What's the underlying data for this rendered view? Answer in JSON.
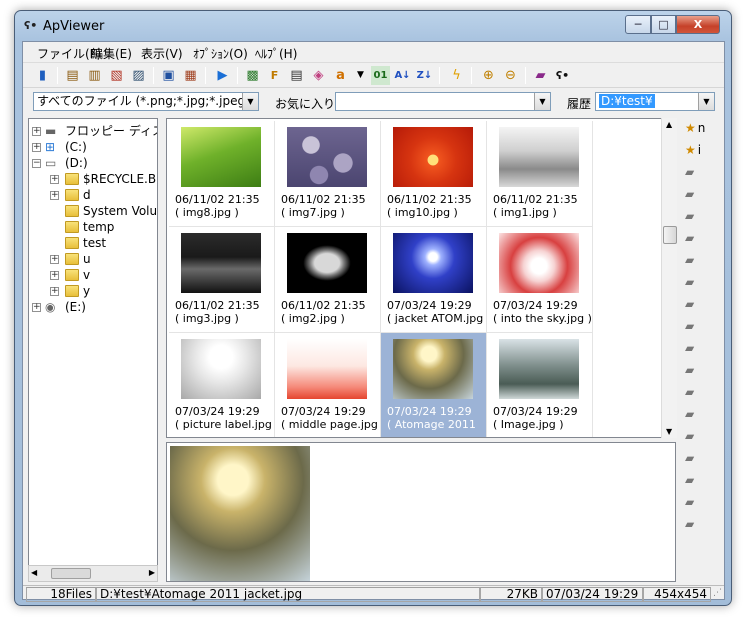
{
  "window": {
    "title": "ApViewer",
    "min": "─",
    "max": "□",
    "close": "X"
  },
  "menu": [
    "ファイル(F)",
    "編集(E)",
    "表示(V)",
    "ｵﾌﾟｼｮﾝ(O)",
    "ﾍﾙﾌﾟ(H)"
  ],
  "filter": {
    "value": "すべてのファイル (*.png;*.jpg;*.jpeg;*.bm"
  },
  "favorites": {
    "label": "お気に入り",
    "value": ""
  },
  "history": {
    "label": "履歴",
    "value": "D:¥test¥"
  },
  "tree": [
    {
      "label": "フロッピー ディスク",
      "icon": "floppy-icon",
      "pm": "+",
      "level": 0
    },
    {
      "label": "(C:)",
      "icon": "windows-drive-icon",
      "pm": "+",
      "level": 0
    },
    {
      "label": "(D:)",
      "icon": "drive-icon",
      "pm": "−",
      "level": 0
    },
    {
      "label": "$RECYCLE.BIN",
      "icon": "folder-icon",
      "pm": "+",
      "level": 1
    },
    {
      "label": "d",
      "icon": "folder-icon",
      "pm": "+",
      "level": 1
    },
    {
      "label": "System Volume",
      "icon": "folder-icon",
      "pm": "",
      "level": 1
    },
    {
      "label": "temp",
      "icon": "folder-icon",
      "pm": "",
      "level": 1
    },
    {
      "label": "test",
      "icon": "folder-icon",
      "pm": "",
      "level": 1
    },
    {
      "label": "u",
      "icon": "folder-icon",
      "pm": "+",
      "level": 1
    },
    {
      "label": "v",
      "icon": "folder-icon",
      "pm": "+",
      "level": 1
    },
    {
      "label": "y",
      "icon": "folder-icon",
      "pm": "+",
      "level": 1
    },
    {
      "label": "(E:)",
      "icon": "cd-drive-icon",
      "pm": "+",
      "level": 0
    }
  ],
  "thumbnails": [
    {
      "date": "06/11/02 21:35",
      "name": "( img8.jpg )",
      "bg": "linear-gradient(160deg,#cfe96a,#6fb12a 45%,#3d7d14)"
    },
    {
      "date": "06/11/02 21:35",
      "name": "( img7.jpg )",
      "bg": "radial-gradient(circle at 30% 30%,#c9c3d8 0 12%,transparent 13%),radial-gradient(circle at 70% 60%,#aca4c4 0 14%,transparent 15%),radial-gradient(circle at 40% 80%,#8f86b0 0 13%,transparent 14%),linear-gradient(#6d6590,#4b4570)"
    },
    {
      "date": "06/11/02 21:35",
      "name": "( img10.jpg )",
      "bg": "radial-gradient(circle at 50% 55%,#ffe07a 0 10%,#f0541e 11%,#d63410 45%,#b51a08)"
    },
    {
      "date": "06/11/02 21:35",
      "name": "( img1.jpg )",
      "bg": "linear-gradient(#f4f4f4,#cfcfcf 40%,#8a8a8a 70%,#d8d8d8)"
    },
    {
      "date": "06/11/02 21:35",
      "name": "( img3.jpg )",
      "bg": "linear-gradient(#2b2b2b,#1a1a1a 40%,#6a6a6a 60%,#111)"
    },
    {
      "date": "06/11/02 21:35",
      "name": "( img2.jpg )",
      "bg": "radial-gradient(ellipse at 50% 50%,#d8d8d8 0 22%,#7a7a7a 30%,#000 42%)"
    },
    {
      "date": "07/03/24 19:29",
      "name": "( jacket ATOM.jpg",
      "bg": "radial-gradient(circle at 50% 40%,#ffffff 0 8%,#9fb2ff 15%,#3040c8 40%,#0a1260)"
    },
    {
      "date": "07/03/24 19:29",
      "name": "( into the sky.jpg )",
      "bg": "radial-gradient(circle at 50% 55%,#ffffff 0 15%,#f6d2d2 30%,#d84040 55%,#fbe3e3)"
    },
    {
      "date": "07/03/24 19:29",
      "name": "( picture label.jpg )",
      "bg": "radial-gradient(circle at 50% 30%,#ffffff 0 20%,#e6e6e6 45%,#a8a8a8)"
    },
    {
      "date": "07/03/24 19:29",
      "name": "( middle page.jpg )",
      "bg": "linear-gradient(#ffffff,#fde8e2 45%,#f58a7a 80%,#e5452f)"
    },
    {
      "date": "07/03/24 19:29",
      "name": "( Atomage 2011",
      "bg": "radial-gradient(circle at 45% 25%,#fff6c8 0 12%,#c9b36a 25%,#6c6a4a 55%,#c6d4dc)",
      "selected": true
    },
    {
      "date": "07/03/24 19:29",
      "name": "( Image.jpg )",
      "bg": "linear-gradient(#d9e2e6,#7d8d8a 45%,#4a5c55 75%,#cfd8d8)"
    }
  ],
  "right_items": [
    {
      "label": "n",
      "icon": "star-folder-icon"
    },
    {
      "label": "i",
      "icon": "star-folder-icon"
    },
    {
      "label": "",
      "icon": "folder-open-icon"
    },
    {
      "label": "",
      "icon": "folder-open-icon"
    },
    {
      "label": "",
      "icon": "folder-open-icon"
    },
    {
      "label": "",
      "icon": "folder-open-icon"
    },
    {
      "label": "",
      "icon": "folder-open-icon"
    },
    {
      "label": "",
      "icon": "folder-open-icon"
    },
    {
      "label": "",
      "icon": "folder-open-icon"
    },
    {
      "label": "",
      "icon": "folder-open-icon"
    },
    {
      "label": "",
      "icon": "folder-open-icon"
    },
    {
      "label": "",
      "icon": "folder-open-icon"
    },
    {
      "label": "",
      "icon": "folder-open-icon"
    },
    {
      "label": "",
      "icon": "folder-open-icon"
    },
    {
      "label": "",
      "icon": "folder-open-icon"
    },
    {
      "label": "",
      "icon": "folder-open-icon"
    },
    {
      "label": "",
      "icon": "folder-open-icon"
    },
    {
      "label": "",
      "icon": "folder-open-icon"
    },
    {
      "label": "",
      "icon": "folder-open-icon"
    }
  ],
  "status": {
    "count": "18Files",
    "path": "D:¥test¥Atomage 2011 jacket.jpg",
    "size": "27KB",
    "date": "07/03/24 19:29",
    "dims": "454x454"
  },
  "colors": {
    "selection": "#9cb3d6",
    "history_highlight": "#3399ff"
  }
}
